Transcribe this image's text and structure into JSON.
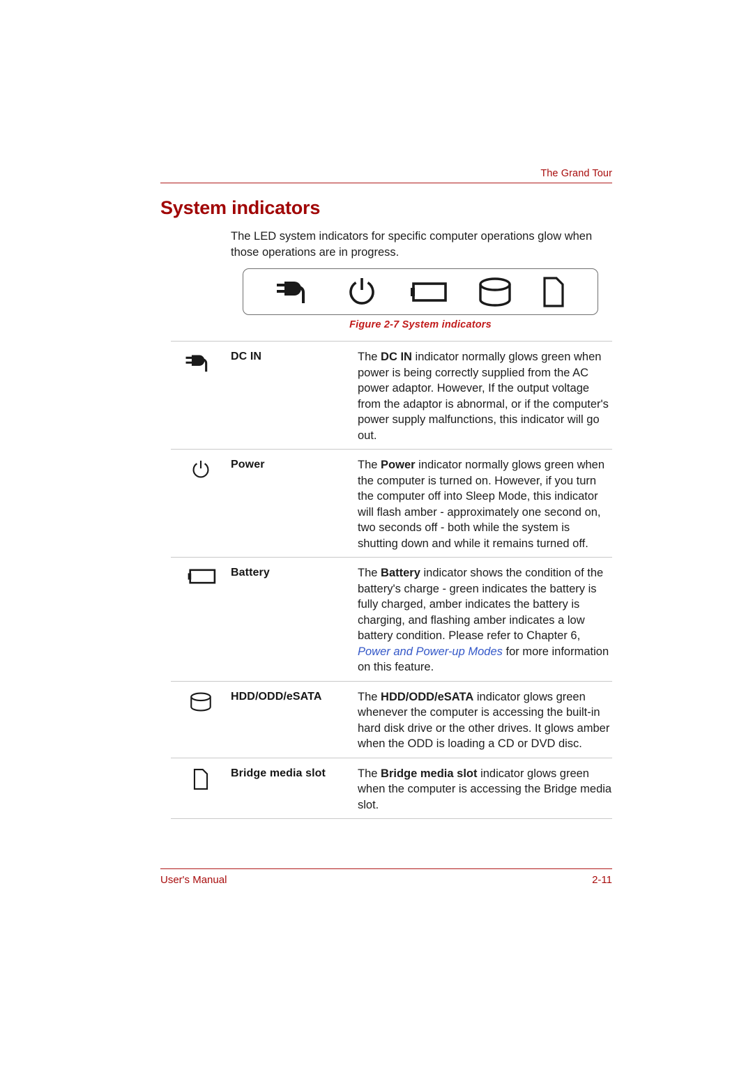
{
  "header": {
    "title": "The Grand Tour",
    "rule_color": "#b01b1b"
  },
  "heading": {
    "text": "System indicators",
    "color": "#a00505"
  },
  "intro": {
    "paragraph": "The LED system indicators for specific computer operations glow when those operations are in progress."
  },
  "figure": {
    "caption": "Figure 2-7 System indicators",
    "caption_color": "#c11b1b",
    "icons": [
      {
        "name": "dc-in-plug-icon",
        "label": "DC IN"
      },
      {
        "name": "power-icon",
        "label": "Power"
      },
      {
        "name": "battery-icon",
        "label": "Battery"
      },
      {
        "name": "hdd-disk-icon",
        "label": "HDD/ODD/eSATA"
      },
      {
        "name": "bridge-media-card-icon",
        "label": "Bridge media slot"
      }
    ]
  },
  "table": {
    "rows": [
      {
        "icon": "dc-in-plug-icon",
        "name": "DC IN",
        "desc_before": "The ",
        "desc_bold": "DC IN",
        "desc_after": " indicator normally glows green when power is being correctly supplied from the AC power adaptor. However, If the output voltage from the adaptor is abnormal, or if the computer's power supply malfunctions, this indicator will go out."
      },
      {
        "icon": "power-icon",
        "name": "Power",
        "desc_before": "The ",
        "desc_bold": "Power",
        "desc_after": " indicator normally glows green when the computer is turned on. However, if you turn the computer off into Sleep Mode, this indicator will flash amber - approximately one second on, two seconds off - both while the system is shutting down and while it remains turned off."
      },
      {
        "icon": "battery-icon",
        "name": "Battery",
        "desc_before": "The ",
        "desc_bold": "Battery",
        "desc_after": " indicator shows the condition of the battery's charge - green indicates the battery is fully charged, amber indicates the battery is charging, and flashing amber indicates a low battery condition. Please refer to Chapter 6, ",
        "desc_link": "Power and Power-up Modes",
        "desc_tail": " for more information on this feature."
      },
      {
        "icon": "hdd-disk-icon",
        "name": "HDD/ODD/eSATA",
        "desc_before": "The ",
        "desc_bold": "HDD/ODD/eSATA",
        "desc_after": " indicator glows green whenever the computer is accessing the built-in hard disk drive or the other drives. It glows amber when the ODD is loading a CD or DVD disc."
      },
      {
        "icon": "bridge-media-card-icon",
        "name": "Bridge media slot",
        "desc_before": "The ",
        "desc_bold": "Bridge media slot",
        "desc_after": " indicator glows green when the computer is accessing the Bridge media slot."
      }
    ]
  },
  "footer": {
    "left": "User's Manual",
    "right": "2-11",
    "color": "#a80d0d"
  }
}
